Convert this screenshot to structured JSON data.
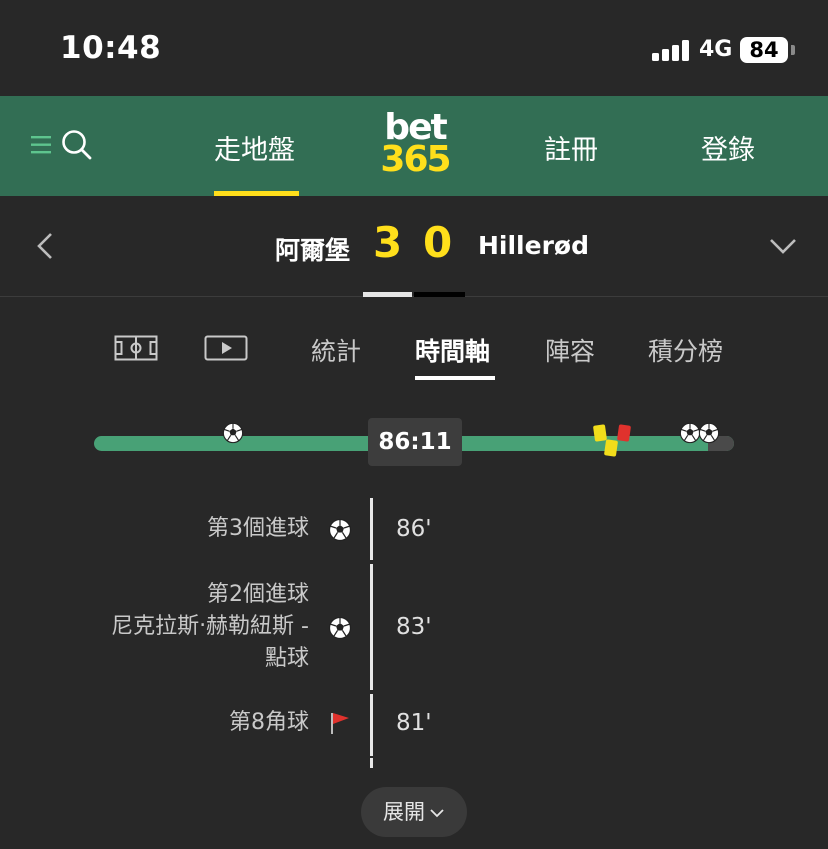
{
  "status_bar": {
    "time": "10:48",
    "network": "4G",
    "battery": "84"
  },
  "nav": {
    "in_play": "走地盤",
    "logo_top": "bet",
    "logo_bottom": "365",
    "register": "註冊",
    "login": "登錄",
    "icons": [
      "menu-icon",
      "search-icon"
    ]
  },
  "match": {
    "home_team": "阿爾堡",
    "home_score": "3",
    "away_score": "0",
    "away_team": "Hillerød"
  },
  "tabs": {
    "icons": [
      "pitch-icon",
      "video-icon"
    ],
    "stats": "統計",
    "timeline": "時間軸",
    "lineups": "陣容",
    "standings": "積分榜",
    "active": "時間軸"
  },
  "match_timeline": {
    "clock": "86:11",
    "progress_minutes": 86,
    "event_icons": [
      "ball-icon",
      "yellow-card-icon",
      "red-card-icon",
      "ball-icon",
      "ball-icon"
    ]
  },
  "events": [
    {
      "label": "第3個進球",
      "time": "86'",
      "icon": "ball-icon"
    },
    {
      "label": "第2個進球",
      "detail_line1": "尼克拉斯‧赫勒紐斯 -",
      "detail_line2": "點球",
      "time": "83'",
      "icon": "ball-icon"
    },
    {
      "label": "第8角球",
      "time": "81'",
      "icon": "corner-flag-icon"
    }
  ],
  "expand_button": "展開",
  "colors": {
    "background": "#282828",
    "nav_green": "#326e54",
    "brand_yellow": "#ffdf1b",
    "timeline_green": "#48a176"
  }
}
